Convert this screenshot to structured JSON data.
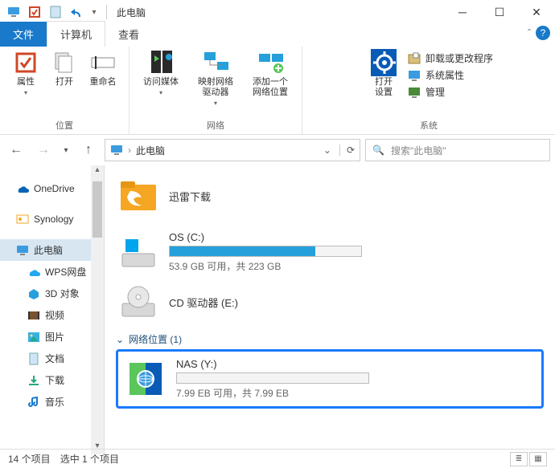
{
  "title": "此电脑",
  "tabs": {
    "file": "文件",
    "computer": "计算机",
    "view": "查看"
  },
  "ribbon": {
    "location": {
      "label": "位置",
      "properties": "属性",
      "open": "打开",
      "rename": "重命名"
    },
    "network": {
      "label": "网络",
      "media": "访问媒体",
      "map": "映射网络\n驱动器",
      "add": "添加一个\n网络位置"
    },
    "system": {
      "label": "系统",
      "settings": "打开\n设置",
      "uninstall": "卸载或更改程序",
      "props": "系统属性",
      "manage": "管理"
    }
  },
  "address": {
    "location": "此电脑"
  },
  "search": {
    "placeholder": "搜索\"此电脑\""
  },
  "tree": {
    "onedrive": "OneDrive",
    "synology": "Synology",
    "thispc": "此电脑",
    "wps": "WPS网盘",
    "obj3d": "3D 对象",
    "video": "视频",
    "pictures": "图片",
    "docs": "文档",
    "downloads": "下载",
    "music": "音乐"
  },
  "content": {
    "folder1": "迅雷下载",
    "drive_c": {
      "name": "OS (C:)",
      "usage": "53.9 GB 可用，共 223 GB"
    },
    "cd": {
      "name": "CD 驱动器 (E:)"
    },
    "section_net": "网络位置 (1)",
    "nas": {
      "name": "NAS (Y:)",
      "usage": "7.99 EB 可用，共 7.99 EB"
    }
  },
  "chart_data": {
    "type": "bar",
    "title": "Drive capacity usage",
    "series": [
      {
        "name": "OS (C:)",
        "free_gb": 53.9,
        "total_gb": 223,
        "fill_percent": 76
      },
      {
        "name": "NAS (Y:)",
        "free_eb": 7.99,
        "total_eb": 7.99,
        "fill_percent": 0
      }
    ]
  },
  "status": {
    "count": "14 个项目",
    "selected": "选中 1 个项目"
  }
}
